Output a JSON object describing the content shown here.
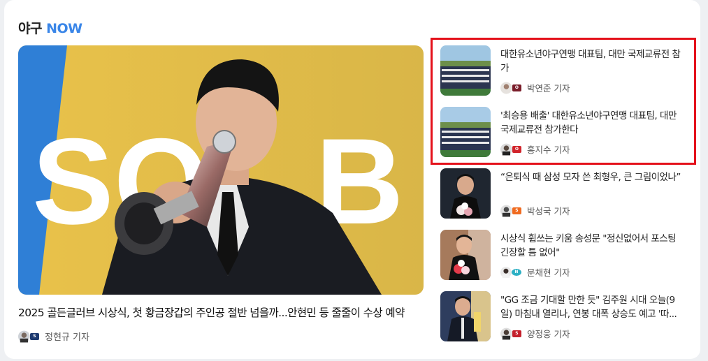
{
  "section": {
    "title_prefix": "야구",
    "title_accent": "NOW"
  },
  "main": {
    "headline": "2025 골든글러브 시상식, 첫 황금장갑의 주인공 절반 넘을까...안현민 등 줄줄이 수상 예약",
    "reporter": "정현규 기자",
    "image_letters": "SOL B"
  },
  "items": [
    {
      "title": "대한유소년야구연맹 대표팀, 대만 국제교류전 참가",
      "reporter": "박연준 기자"
    },
    {
      "title": "'최승용 배출' 대한유소년야구연맹 대표팀, 대만 국제교류전 참가한다",
      "reporter": "홍지수 기자"
    },
    {
      "title": "“은퇴식 때 삼성 모자 쓴 최형우, 큰 그림이었나”",
      "reporter": "박성국 기자"
    },
    {
      "title": "시상식 휩쓰는 키움 송성문 \"정신없어서 포스팅 긴장할 틈 없어\"",
      "reporter": "문채현 기자"
    },
    {
      "title": "\"GG 조금 기대할 만한 듯\" 김주원 시대 오늘(9일) 마침내 열리나, 연봉 대폭 상승도 예고 '따...",
      "reporter": "양정웅 기자"
    }
  ],
  "colors": {
    "accent": "#3a86e8",
    "highlight": "#e4111b"
  }
}
